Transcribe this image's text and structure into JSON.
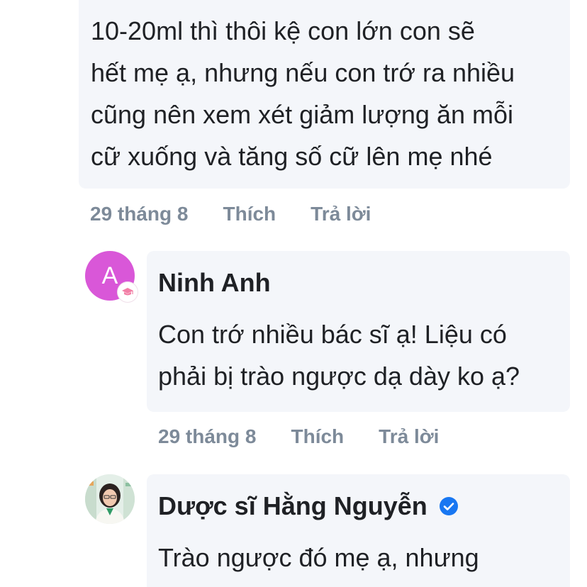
{
  "comment_prev": {
    "body": "10-20ml thì thôi kệ con lớn con sẽ\nhết mẹ ạ, nhưng nếu con trớ ra nhiều\ncũng nên xem xét giảm lượng ăn mỗi\ncữ xuống và tăng số cữ lên mẹ nhé",
    "date": "29 tháng 8",
    "like_label": "Thích",
    "reply_label": "Trả lời"
  },
  "comment_ninh": {
    "avatar_letter": "A",
    "name": "Ninh Anh",
    "body": "Con trớ nhiều bác sĩ ạ! Liệu có\nphải bị trào ngược dạ dày ko ạ?",
    "date": "29 tháng 8",
    "like_label": "Thích",
    "reply_label": "Trả lời",
    "badge_icon": "graduation-cap-icon"
  },
  "comment_hang": {
    "name": "Dược sĩ Hằng Nguyễn",
    "body": "Trào ngược đó mẹ ạ, nhưng",
    "verified_icon": "verified-check-icon"
  },
  "colors": {
    "bubble": "#f4f6fa",
    "meta_text": "#7d8a99",
    "avatar_pink": "#d957d8",
    "verified_blue": "#1877f2"
  }
}
